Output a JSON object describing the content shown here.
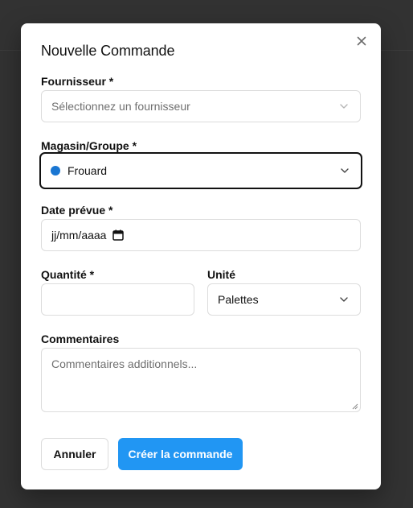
{
  "modal": {
    "title": "Nouvelle Commande",
    "close_icon": "close-icon"
  },
  "form": {
    "supplier": {
      "label": "Fournisseur *",
      "placeholder": "Sélectionnez un fournisseur"
    },
    "store": {
      "label": "Magasin/Groupe *",
      "value": "Frouard",
      "dot_color": "#1976d2"
    },
    "date": {
      "label": "Date prévue *",
      "value": "jj/mm/aaaa"
    },
    "quantity": {
      "label": "Quantité *",
      "value": ""
    },
    "unit": {
      "label": "Unité",
      "value": "Palettes"
    },
    "comments": {
      "label": "Commentaires",
      "placeholder": "Commentaires additionnels..."
    }
  },
  "actions": {
    "cancel_label": "Annuler",
    "create_label": "Créer la commande",
    "create_color": "#2196f3"
  }
}
